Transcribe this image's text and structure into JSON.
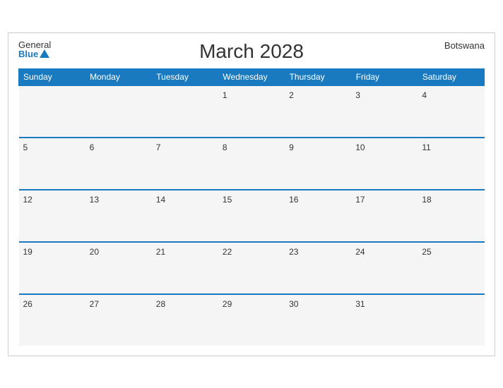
{
  "header": {
    "title": "March 2028",
    "country": "Botswana",
    "logo_general": "General",
    "logo_blue": "Blue"
  },
  "days_of_week": [
    "Sunday",
    "Monday",
    "Tuesday",
    "Wednesday",
    "Thursday",
    "Friday",
    "Saturday"
  ],
  "weeks": [
    [
      {
        "day": "",
        "empty": true
      },
      {
        "day": "",
        "empty": true
      },
      {
        "day": "",
        "empty": true
      },
      {
        "day": "1",
        "empty": false
      },
      {
        "day": "2",
        "empty": false
      },
      {
        "day": "3",
        "empty": false
      },
      {
        "day": "4",
        "empty": false
      }
    ],
    [
      {
        "day": "5",
        "empty": false
      },
      {
        "day": "6",
        "empty": false
      },
      {
        "day": "7",
        "empty": false
      },
      {
        "day": "8",
        "empty": false
      },
      {
        "day": "9",
        "empty": false
      },
      {
        "day": "10",
        "empty": false
      },
      {
        "day": "11",
        "empty": false
      }
    ],
    [
      {
        "day": "12",
        "empty": false
      },
      {
        "day": "13",
        "empty": false
      },
      {
        "day": "14",
        "empty": false
      },
      {
        "day": "15",
        "empty": false
      },
      {
        "day": "16",
        "empty": false
      },
      {
        "day": "17",
        "empty": false
      },
      {
        "day": "18",
        "empty": false
      }
    ],
    [
      {
        "day": "19",
        "empty": false
      },
      {
        "day": "20",
        "empty": false
      },
      {
        "day": "21",
        "empty": false
      },
      {
        "day": "22",
        "empty": false
      },
      {
        "day": "23",
        "empty": false
      },
      {
        "day": "24",
        "empty": false
      },
      {
        "day": "25",
        "empty": false
      }
    ],
    [
      {
        "day": "26",
        "empty": false
      },
      {
        "day": "27",
        "empty": false
      },
      {
        "day": "28",
        "empty": false
      },
      {
        "day": "29",
        "empty": false
      },
      {
        "day": "30",
        "empty": false
      },
      {
        "day": "31",
        "empty": false
      },
      {
        "day": "",
        "empty": true
      }
    ]
  ]
}
